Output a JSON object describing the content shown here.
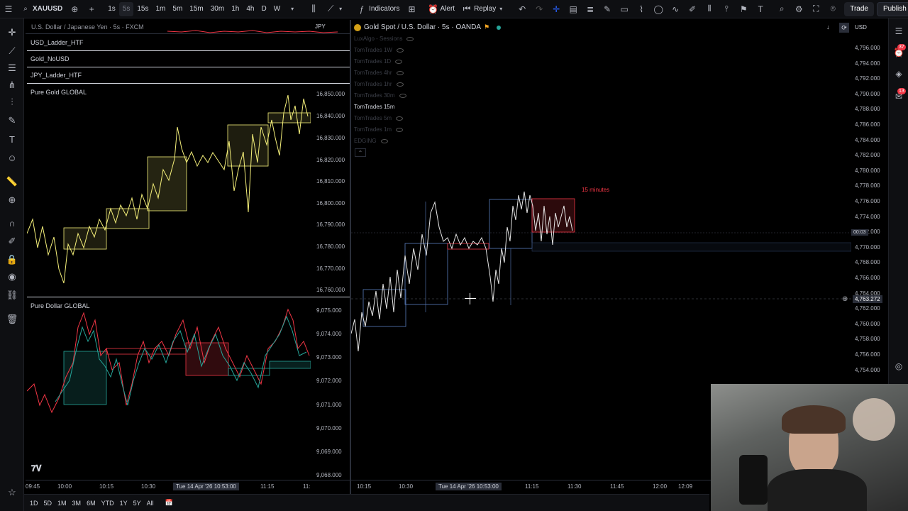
{
  "toolbar": {
    "symbol": "XAUUSD",
    "intervals": [
      "1s",
      "5s",
      "15s",
      "1m",
      "5m",
      "15m",
      "30m",
      "1h",
      "4h",
      "D",
      "W"
    ],
    "active_interval": "5s",
    "indicators_label": "Indicators",
    "alert_label": "Alert",
    "replay_label": "Replay",
    "trade_label": "Trade",
    "publish_label": "Publish"
  },
  "left_pane": {
    "top_title": "U.S. Dollar / Japanese Yen · 5s · FXCM",
    "top_currency": "JPY",
    "strips": [
      "USD_Ladder_HTF",
      "Gold_NoUSD",
      "JPY_Ladder_HTF"
    ],
    "gold_title": "Pure Gold GLOBAL",
    "gold_yaxis": [
      "16,850.000",
      "16,840.000",
      "16,830.000",
      "16,820.000",
      "16,810.000",
      "16,800.000",
      "16,790.000",
      "16,780.000",
      "16,770.000",
      "16,760.000"
    ],
    "dollar_title": "Pure Dollar GLOBAL",
    "dollar_yaxis": [
      "9,075.000",
      "9,074.000",
      "9,073.000",
      "9,072.000",
      "9,071.000",
      "9,070.000",
      "9,069.000",
      "9,068.000"
    ],
    "xaxis": [
      "09:45",
      "10:00",
      "10:15",
      "10:30",
      "11:15",
      "11:"
    ],
    "xaxis_pill": "Tue 14 Apr '26   10:53:00"
  },
  "right_pane": {
    "title": "Gold Spot / U.S. Dollar · 5s · OANDA",
    "currency": "USD",
    "indicators": [
      "LuxAlgo - Sessions",
      "TomTrades 1W",
      "TomTrades 1D",
      "TomTrades 4hr",
      "TomTrades 1hr",
      "TomTrades 30m",
      "TomTrades 15m",
      "TomTrades 5m",
      "TomTrades 1m",
      "EDGING"
    ],
    "bright_indicator": "TomTrades 15m",
    "box_label": "15 minutes",
    "yaxis": [
      "4,796.000",
      "4,794.000",
      "4,792.000",
      "4,790.000",
      "4,788.000",
      "4,786.000",
      "4,784.000",
      "4,782.000",
      "4,780.000",
      "4,778.000",
      "4,776.000",
      "4,774.000",
      "4,772.000",
      "4,770.000",
      "4,768.000",
      "4,766.000",
      "4,764.000",
      "4,762.000",
      "4,760.000",
      "4,758.000",
      "4,756.000",
      "4,754.000"
    ],
    "crosshair_price": "4,763.272",
    "countdown": "00:03",
    "xaxis": [
      "10:15",
      "10:30",
      "11:15",
      "11:30",
      "11:45",
      "12:00",
      "12:09"
    ],
    "xaxis_pill": "Tue 14 Apr '26   10:53:00"
  },
  "bottom_ranges": [
    "1D",
    "5D",
    "1M",
    "3M",
    "6M",
    "YTD",
    "1Y",
    "5Y",
    "All"
  ],
  "badges": {
    "alerts": "37",
    "notifications": "13"
  },
  "colors": {
    "gold_line": "#f5f07a",
    "box_red": "#f23645",
    "box_green": "#26a69a",
    "box_blue": "#5b7fbf",
    "accent": "#2962ff"
  }
}
